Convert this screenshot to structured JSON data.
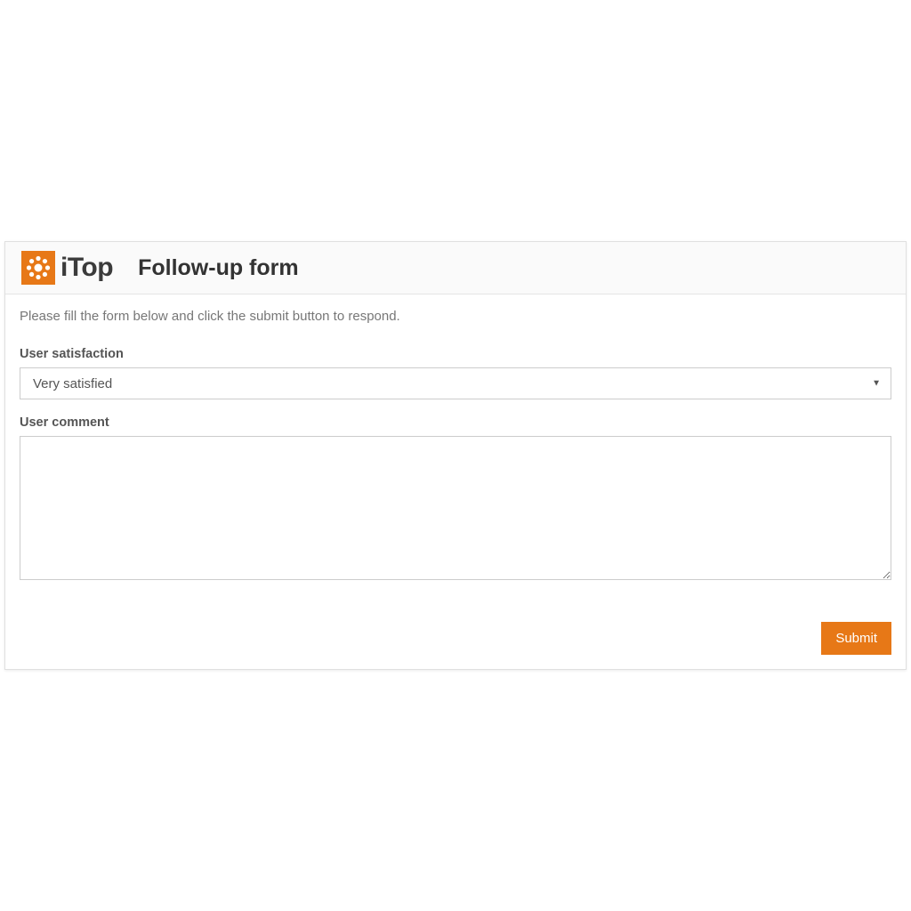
{
  "logo": {
    "text": "iTop"
  },
  "header": {
    "title": "Follow-up form"
  },
  "instructions": "Please fill the form below and click the submit button to respond.",
  "fields": {
    "satisfaction": {
      "label": "User satisfaction",
      "selected": "Very satisfied"
    },
    "comment": {
      "label": "User comment",
      "value": ""
    }
  },
  "buttons": {
    "submit": "Submit"
  },
  "colors": {
    "accent": "#e77817"
  }
}
